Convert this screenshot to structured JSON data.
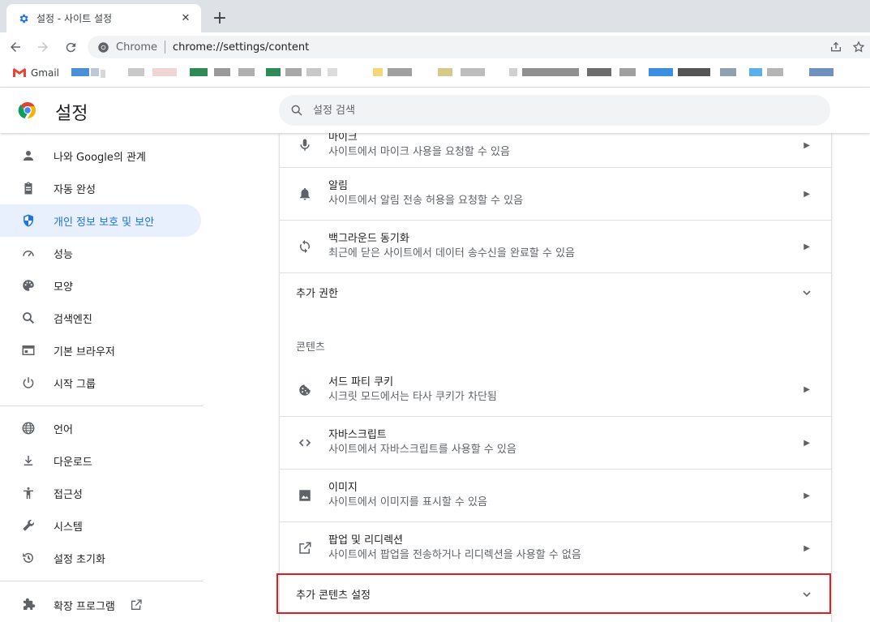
{
  "browser": {
    "tab_title": "설정 - 사이트 설정",
    "tab_close": "✕",
    "new_tab": "+",
    "omnibox_chip": "Chrome",
    "url": "chrome://settings/content",
    "bookmark_gmail": "Gmail"
  },
  "header": {
    "title": "설정",
    "search_placeholder": "설정 검색"
  },
  "sidebar": {
    "items": [
      {
        "label": "나와 Google의 관계",
        "icon": "person-icon"
      },
      {
        "label": "자동 완성",
        "icon": "clipboard-icon"
      },
      {
        "label": "개인 정보 보호 및 보안",
        "icon": "shield-icon",
        "selected": true
      },
      {
        "label": "성능",
        "icon": "speedometer-icon"
      },
      {
        "label": "모양",
        "icon": "palette-icon"
      },
      {
        "label": "검색엔진",
        "icon": "search-icon"
      },
      {
        "label": "기본 브라우저",
        "icon": "browser-window-icon"
      },
      {
        "label": "시작 그룹",
        "icon": "power-icon"
      },
      {
        "label": "언어",
        "icon": "globe-icon"
      },
      {
        "label": "다운로드",
        "icon": "download-icon"
      },
      {
        "label": "접근성",
        "icon": "accessibility-icon"
      },
      {
        "label": "시스템",
        "icon": "wrench-icon"
      },
      {
        "label": "설정 초기화",
        "icon": "history-icon"
      },
      {
        "label": "확장 프로그램",
        "icon": "puzzle-icon"
      }
    ]
  },
  "main": {
    "mic": {
      "title": "마이크",
      "sub": "사이트에서 마이크 사용을 요청할 수 있음"
    },
    "notifications": {
      "title": "알림",
      "sub": "사이트에서 알림 전송 허용을 요청할 수 있음"
    },
    "background_sync": {
      "title": "백그라운드 동기화",
      "sub": "최근에 닫은 사이트에서 데이터 송수신을 완료할 수 있음"
    },
    "more_permissions": "추가 권한",
    "content_heading": "콘텐츠",
    "cookies": {
      "title": "서드 파티 쿠키",
      "sub": "시크릿 모드에서는 타사 쿠키가 차단됨"
    },
    "javascript": {
      "title": "자바스크립트",
      "sub": "사이트에서 자바스크립트를 사용할 수 있음"
    },
    "images": {
      "title": "이미지",
      "sub": "사이트에서 이미지를 표시할 수 있음"
    },
    "popups": {
      "title": "팝업 및 리디렉션",
      "sub": "사이트에서 팝업을 전송하거나 리디렉션을 사용할 수 없음"
    },
    "more_content_settings": "추가 콘텐츠 설정"
  },
  "colors": {
    "accent": "#1a73e8",
    "selected_bg": "#e8f0fe",
    "highlight_border": "#e02020"
  }
}
